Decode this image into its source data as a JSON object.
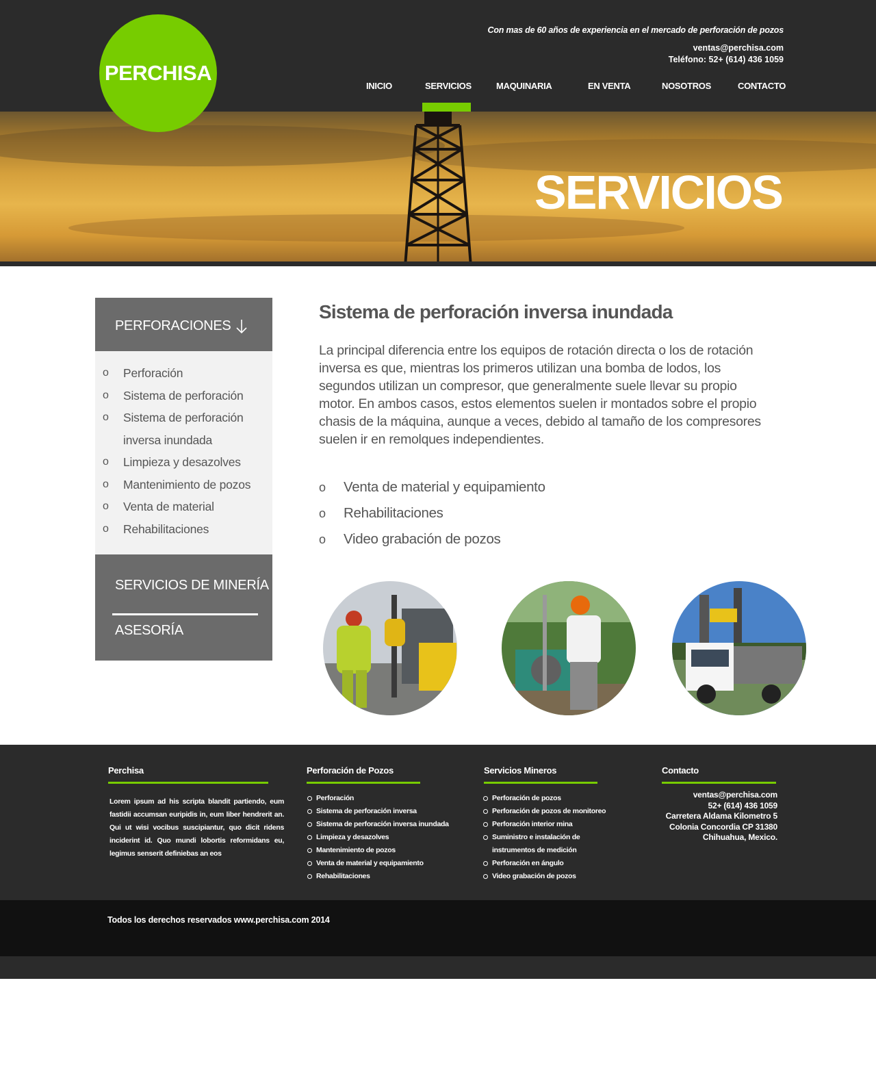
{
  "brand": {
    "name": "PERCHISA",
    "green": "#77cc00",
    "dark": "#2b2b2b"
  },
  "header": {
    "tagline": "Con mas de  60 años de experiencia  en el mercado de perforación de pozos",
    "email": "ventas@perchisa.com",
    "phone": "Teléfono: 52+ (614) 436 1059"
  },
  "nav": {
    "items": [
      {
        "label": "INICIO"
      },
      {
        "label": "SERVICIOS",
        "active": true
      },
      {
        "label": "MAQUINARIA"
      },
      {
        "label": "EN VENTA"
      },
      {
        "label": "NOSOTROS"
      },
      {
        "label": "CONTACTO"
      }
    ]
  },
  "hero": {
    "title": "SERVICIOS"
  },
  "sidebar": {
    "heading": "PERFORACIONES",
    "items": [
      {
        "label": "Perforación"
      },
      {
        "label": "Sistema de perforación"
      },
      {
        "label": "Sistema de perforación inversa inundada"
      },
      {
        "label": "Limpieza y desazolves"
      },
      {
        "label": "Mantenimiento de pozos"
      },
      {
        "label": "Venta de material"
      },
      {
        "label": "Rehabilitaciones"
      }
    ],
    "links": [
      {
        "label": "SERVICIOS DE MINERÍA"
      },
      {
        "label": "ASESORÍA"
      }
    ]
  },
  "main": {
    "title": "Sistema de perforación inversa inundada",
    "paragraph": "La principal diferencia entre los equipos de rotación directa  o los de rotación inversa es que, mientras los primeros utilizan una bomba de lodos, los segundos utilizan un compresor, que generalmente suele llevar su propio motor. En ambos casos, estos elementos suelen ir montados sobre el propio chasis de la máquina, aunque a veces, debido al tamaño de los compresores suelen ir en remolques independientes.",
    "list": [
      {
        "label": "Venta de material y equipamiento"
      },
      {
        "label": "Rehabilitaciones"
      },
      {
        "label": "Video grabación de pozos"
      }
    ],
    "bullet": "o"
  },
  "footer": {
    "col1": {
      "title": "Perchisa",
      "text": "Lorem ipsum ad his scripta blandit partiendo, eum fastidii accumsan euripidis in, eum liber hendrerit an. Qui ut wisi vocibus suscipiantur, quo dicit ridens inciderint id. Quo mundi lobortis reformidans eu, legimus senserit definiebas an eos"
    },
    "col2": {
      "title": "Perforación de Pozos",
      "items": [
        "Perforación",
        "Sistema de perforación inversa",
        "Sistema de perforación inversa inundada",
        "Limpieza y desazolves",
        "Mantenimiento de pozos",
        "Venta de material y equipamiento",
        "Rehabilitaciones"
      ]
    },
    "col3": {
      "title": "Servicios Mineros",
      "items": [
        "Perforación de pozos",
        "Perforación de pozos de monitoreo",
        "Perforación interior mina",
        "Suministro e instalación de instrumentos de medición",
        "Perforación en ángulo",
        "Video grabación de pozos"
      ]
    },
    "col4": {
      "title": "Contacto",
      "lines": [
        "ventas@perchisa.com",
        "52+ (614) 436 1059",
        "Carretera Aldama Kilometro 5",
        "Colonia Concordia CP 31380",
        "Chihuahua, Mexico."
      ]
    },
    "copyright": "Todos los derechos reservados www.perchisa.com 2014"
  }
}
